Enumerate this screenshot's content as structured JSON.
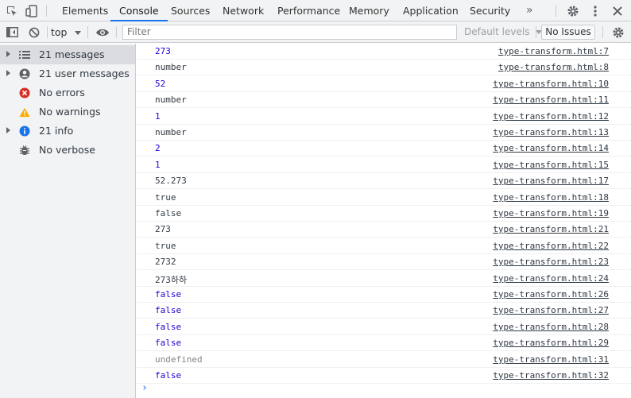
{
  "tabs": [
    {
      "label": "Elements"
    },
    {
      "label": "Console"
    },
    {
      "label": "Sources"
    },
    {
      "label": "Network"
    },
    {
      "label": "Performance"
    },
    {
      "label": "Memory"
    },
    {
      "label": "Application"
    },
    {
      "label": "Security"
    }
  ],
  "tabs_more": "»",
  "toolbar": {
    "context": "top",
    "filter_placeholder": "Filter",
    "default_levels": "Default levels",
    "no_issues": "No Issues"
  },
  "sidebar": {
    "items": [
      {
        "label": "21 messages",
        "icon": "list-icon",
        "expandable": true,
        "selected": true
      },
      {
        "label": "21 user messages",
        "icon": "user-icon",
        "expandable": true,
        "selected": false
      },
      {
        "label": "No errors",
        "icon": "error-icon",
        "expandable": false,
        "selected": false
      },
      {
        "label": "No warnings",
        "icon": "warning-icon",
        "expandable": false,
        "selected": false
      },
      {
        "label": "21 info",
        "icon": "info-icon",
        "expandable": true,
        "selected": false
      },
      {
        "label": "No verbose",
        "icon": "verbose-icon",
        "expandable": false,
        "selected": false
      }
    ]
  },
  "colors": {
    "accent": "#1a73e8",
    "string_value": "#1c00cf",
    "number_value": "#1c00cf",
    "undefined_value": "#80868b",
    "error": "#d93025",
    "warning": "#f9ab00"
  },
  "log": [
    {
      "text": "273",
      "kind": "number",
      "source": "type-transform.html:7"
    },
    {
      "text": "number",
      "kind": "string",
      "source": "type-transform.html:8"
    },
    {
      "text": "52",
      "kind": "number",
      "source": "type-transform.html:10"
    },
    {
      "text": "number",
      "kind": "string",
      "source": "type-transform.html:11"
    },
    {
      "text": "1",
      "kind": "number",
      "source": "type-transform.html:12"
    },
    {
      "text": "number",
      "kind": "string",
      "source": "type-transform.html:13"
    },
    {
      "text": "2",
      "kind": "number",
      "source": "type-transform.html:14"
    },
    {
      "text": "1",
      "kind": "number",
      "source": "type-transform.html:15"
    },
    {
      "text": "52.273",
      "kind": "string",
      "source": "type-transform.html:17"
    },
    {
      "text": "true",
      "kind": "string",
      "source": "type-transform.html:18"
    },
    {
      "text": "false",
      "kind": "string",
      "source": "type-transform.html:19"
    },
    {
      "text": "273",
      "kind": "string",
      "source": "type-transform.html:21"
    },
    {
      "text": "true",
      "kind": "string",
      "source": "type-transform.html:22"
    },
    {
      "text": "2732",
      "kind": "string",
      "source": "type-transform.html:23"
    },
    {
      "text": "273하하",
      "kind": "string",
      "source": "type-transform.html:24"
    },
    {
      "text": "false",
      "kind": "boolean",
      "source": "type-transform.html:26"
    },
    {
      "text": "false",
      "kind": "boolean",
      "source": "type-transform.html:27"
    },
    {
      "text": "false",
      "kind": "boolean",
      "source": "type-transform.html:28"
    },
    {
      "text": "false",
      "kind": "boolean",
      "source": "type-transform.html:29"
    },
    {
      "text": "undefined",
      "kind": "undefined",
      "source": "type-transform.html:31"
    },
    {
      "text": "false",
      "kind": "boolean",
      "source": "type-transform.html:32"
    }
  ],
  "prompt": "›"
}
